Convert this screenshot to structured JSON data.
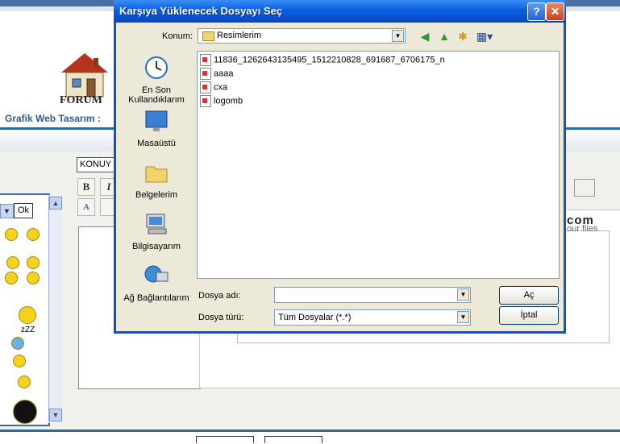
{
  "background": {
    "forum_label": "FORUM",
    "site_title": "Grafik Web Tasarım :",
    "konu_label": "KONUY",
    "ok_label": "Ok",
    "bold_label": "B",
    "italic_label": "I",
    "brand_text": "com",
    "brand_sub": "our files",
    "zzz_label": "zZZ"
  },
  "dialog": {
    "title": "Karşıya Yüklenecek Dosyayı Seç",
    "help_label": "?",
    "close_label": "✕",
    "look_in_label": "Konum:",
    "look_in_value": "Resimlerim",
    "places": [
      {
        "icon": "recent-icon",
        "label": "En Son Kullandıklarım"
      },
      {
        "icon": "desktop-icon",
        "label": "Masaüstü"
      },
      {
        "icon": "my-documents-icon",
        "label": "Belgelerim"
      },
      {
        "icon": "my-computer-icon",
        "label": "Bilgisayarım"
      },
      {
        "icon": "network-icon",
        "label": "Ağ Bağlantılarım"
      }
    ],
    "files": [
      "11836_1262643135495_1512210828_691687_6706175_n",
      "aaaa",
      "cxa",
      "logomb"
    ],
    "filename_label": "Dosya adı:",
    "filename_value": "",
    "filetype_label": "Dosya türü:",
    "filetype_value": "Tüm Dosyalar (*.*)",
    "open_button": "Aç",
    "cancel_button": "İptal"
  },
  "colors": {
    "titlebar": "#0a5fe0",
    "dialog_bg": "#ece9d8",
    "accent_blue": "#2a6ea0"
  }
}
